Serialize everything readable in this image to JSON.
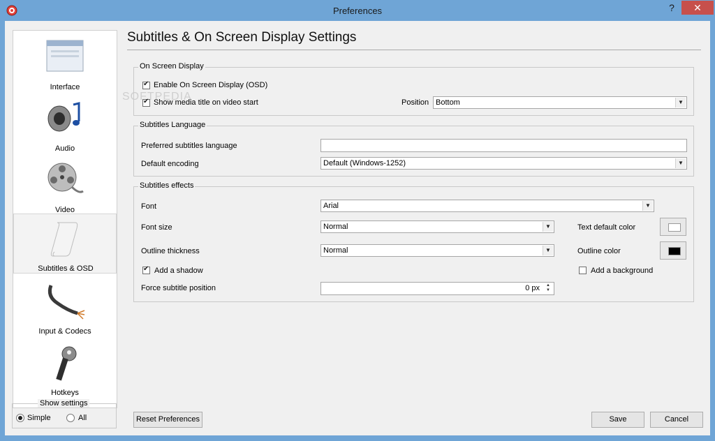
{
  "window": {
    "title": "Preferences",
    "help": "?",
    "close": "✕"
  },
  "sidebar": {
    "items": [
      {
        "label": "Interface",
        "icon": "interface-icon"
      },
      {
        "label": "Audio",
        "icon": "audio-icon"
      },
      {
        "label": "Video",
        "icon": "video-icon"
      },
      {
        "label": "Subtitles & OSD",
        "icon": "subtitles-icon",
        "selected": true
      },
      {
        "label": "Input & Codecs",
        "icon": "input-codecs-icon"
      },
      {
        "label": "Hotkeys",
        "icon": "hotkeys-icon"
      }
    ],
    "show_settings": {
      "title": "Show settings",
      "simple": "Simple",
      "all": "All",
      "selected": "Simple"
    }
  },
  "main": {
    "title": "Subtitles & On Screen Display Settings",
    "osd": {
      "title": "On Screen Display",
      "enable_osd": "Enable On Screen Display (OSD)",
      "enable_osd_checked": true,
      "show_media_title": "Show media title on video start",
      "show_media_title_checked": true,
      "position_label": "Position",
      "position_value": "Bottom"
    },
    "language": {
      "title": "Subtitles Language",
      "preferred_label": "Preferred subtitles language",
      "preferred_value": "",
      "encoding_label": "Default encoding",
      "encoding_value": "Default (Windows-1252)"
    },
    "effects": {
      "title": "Subtitles effects",
      "font_label": "Font",
      "font_value": "Arial",
      "font_size_label": "Font size",
      "font_size_value": "Normal",
      "outline_label": "Outline thickness",
      "outline_value": "Normal",
      "text_color_label": "Text default color",
      "text_color": "#ffffff",
      "outline_color_label": "Outline color",
      "outline_color": "#000000",
      "shadow_label": "Add a shadow",
      "shadow_checked": true,
      "background_label": "Add a background",
      "background_checked": false,
      "force_position_label": "Force subtitle position",
      "force_position_value": "0 px"
    }
  },
  "footer": {
    "reset": "Reset Preferences",
    "save": "Save",
    "cancel": "Cancel"
  },
  "watermark": "SOFTPEDIA"
}
